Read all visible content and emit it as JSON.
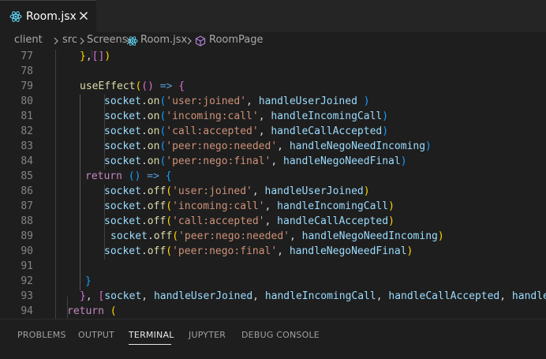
{
  "tab": {
    "title": "Room.jsx",
    "icon": "react-icon",
    "close_icon": "close-icon"
  },
  "breadcrumb": [
    "client",
    "src",
    "Screens",
    "Room.jsx",
    "RoomPage"
  ],
  "lines": [
    {
      "num": "77",
      "text": "},[])"
    },
    {
      "num": "78",
      "text": ""
    },
    {
      "num": "79",
      "text": "useEffect(() => {"
    },
    {
      "num": "80",
      "text": "socket.on('user:joined', handleUserJoined )"
    },
    {
      "num": "81",
      "text": "socket.on('incoming:call', handleIncomingCall)"
    },
    {
      "num": "82",
      "text": "socket.on('call:accepted', handleCallAccepted)"
    },
    {
      "num": "83",
      "text": "socket.on('peer:nego:needed', handleNegoNeedIncoming)"
    },
    {
      "num": "84",
      "text": "socket.on('peer:nego:final', handleNegoNeedFinal)"
    },
    {
      "num": "85",
      "text": "return () => {"
    },
    {
      "num": "86",
      "text": "socket.off('user:joined', handleUserJoined)"
    },
    {
      "num": "87",
      "text": "socket.off('incoming:call', handleIncomingCall)"
    },
    {
      "num": "88",
      "text": "socket.off('call:accepted', handleCallAccepted)"
    },
    {
      "num": "89",
      "text": "socket.off('peer:nego:needed', handleNegoNeedIncoming)"
    },
    {
      "num": "90",
      "text": "socket.off('peer:nego:final', handleNegoNeedFinal)"
    },
    {
      "num": "91",
      "text": ""
    },
    {
      "num": "92",
      "text": "}"
    },
    {
      "num": "93",
      "text": "}, [socket, handleUserJoined, handleIncomingCall, handleCallAccepted, handleN"
    },
    {
      "num": "94",
      "text": "return ("
    }
  ],
  "panel": {
    "tabs": [
      "PROBLEMS",
      "OUTPUT",
      "TERMINAL",
      "JUPYTER",
      "DEBUG CONSOLE"
    ],
    "active": "TERMINAL"
  },
  "colors": {
    "keyword": "#569cd6",
    "control": "#c586c0",
    "function": "#dcdcaa",
    "variable": "#9cdcfe",
    "string": "#ce9178",
    "punctuation": "#d4d4d4",
    "bracket_gold": "#ffd700",
    "bracket_orchid": "#da70d6",
    "bracket_blue": "#179fff"
  }
}
